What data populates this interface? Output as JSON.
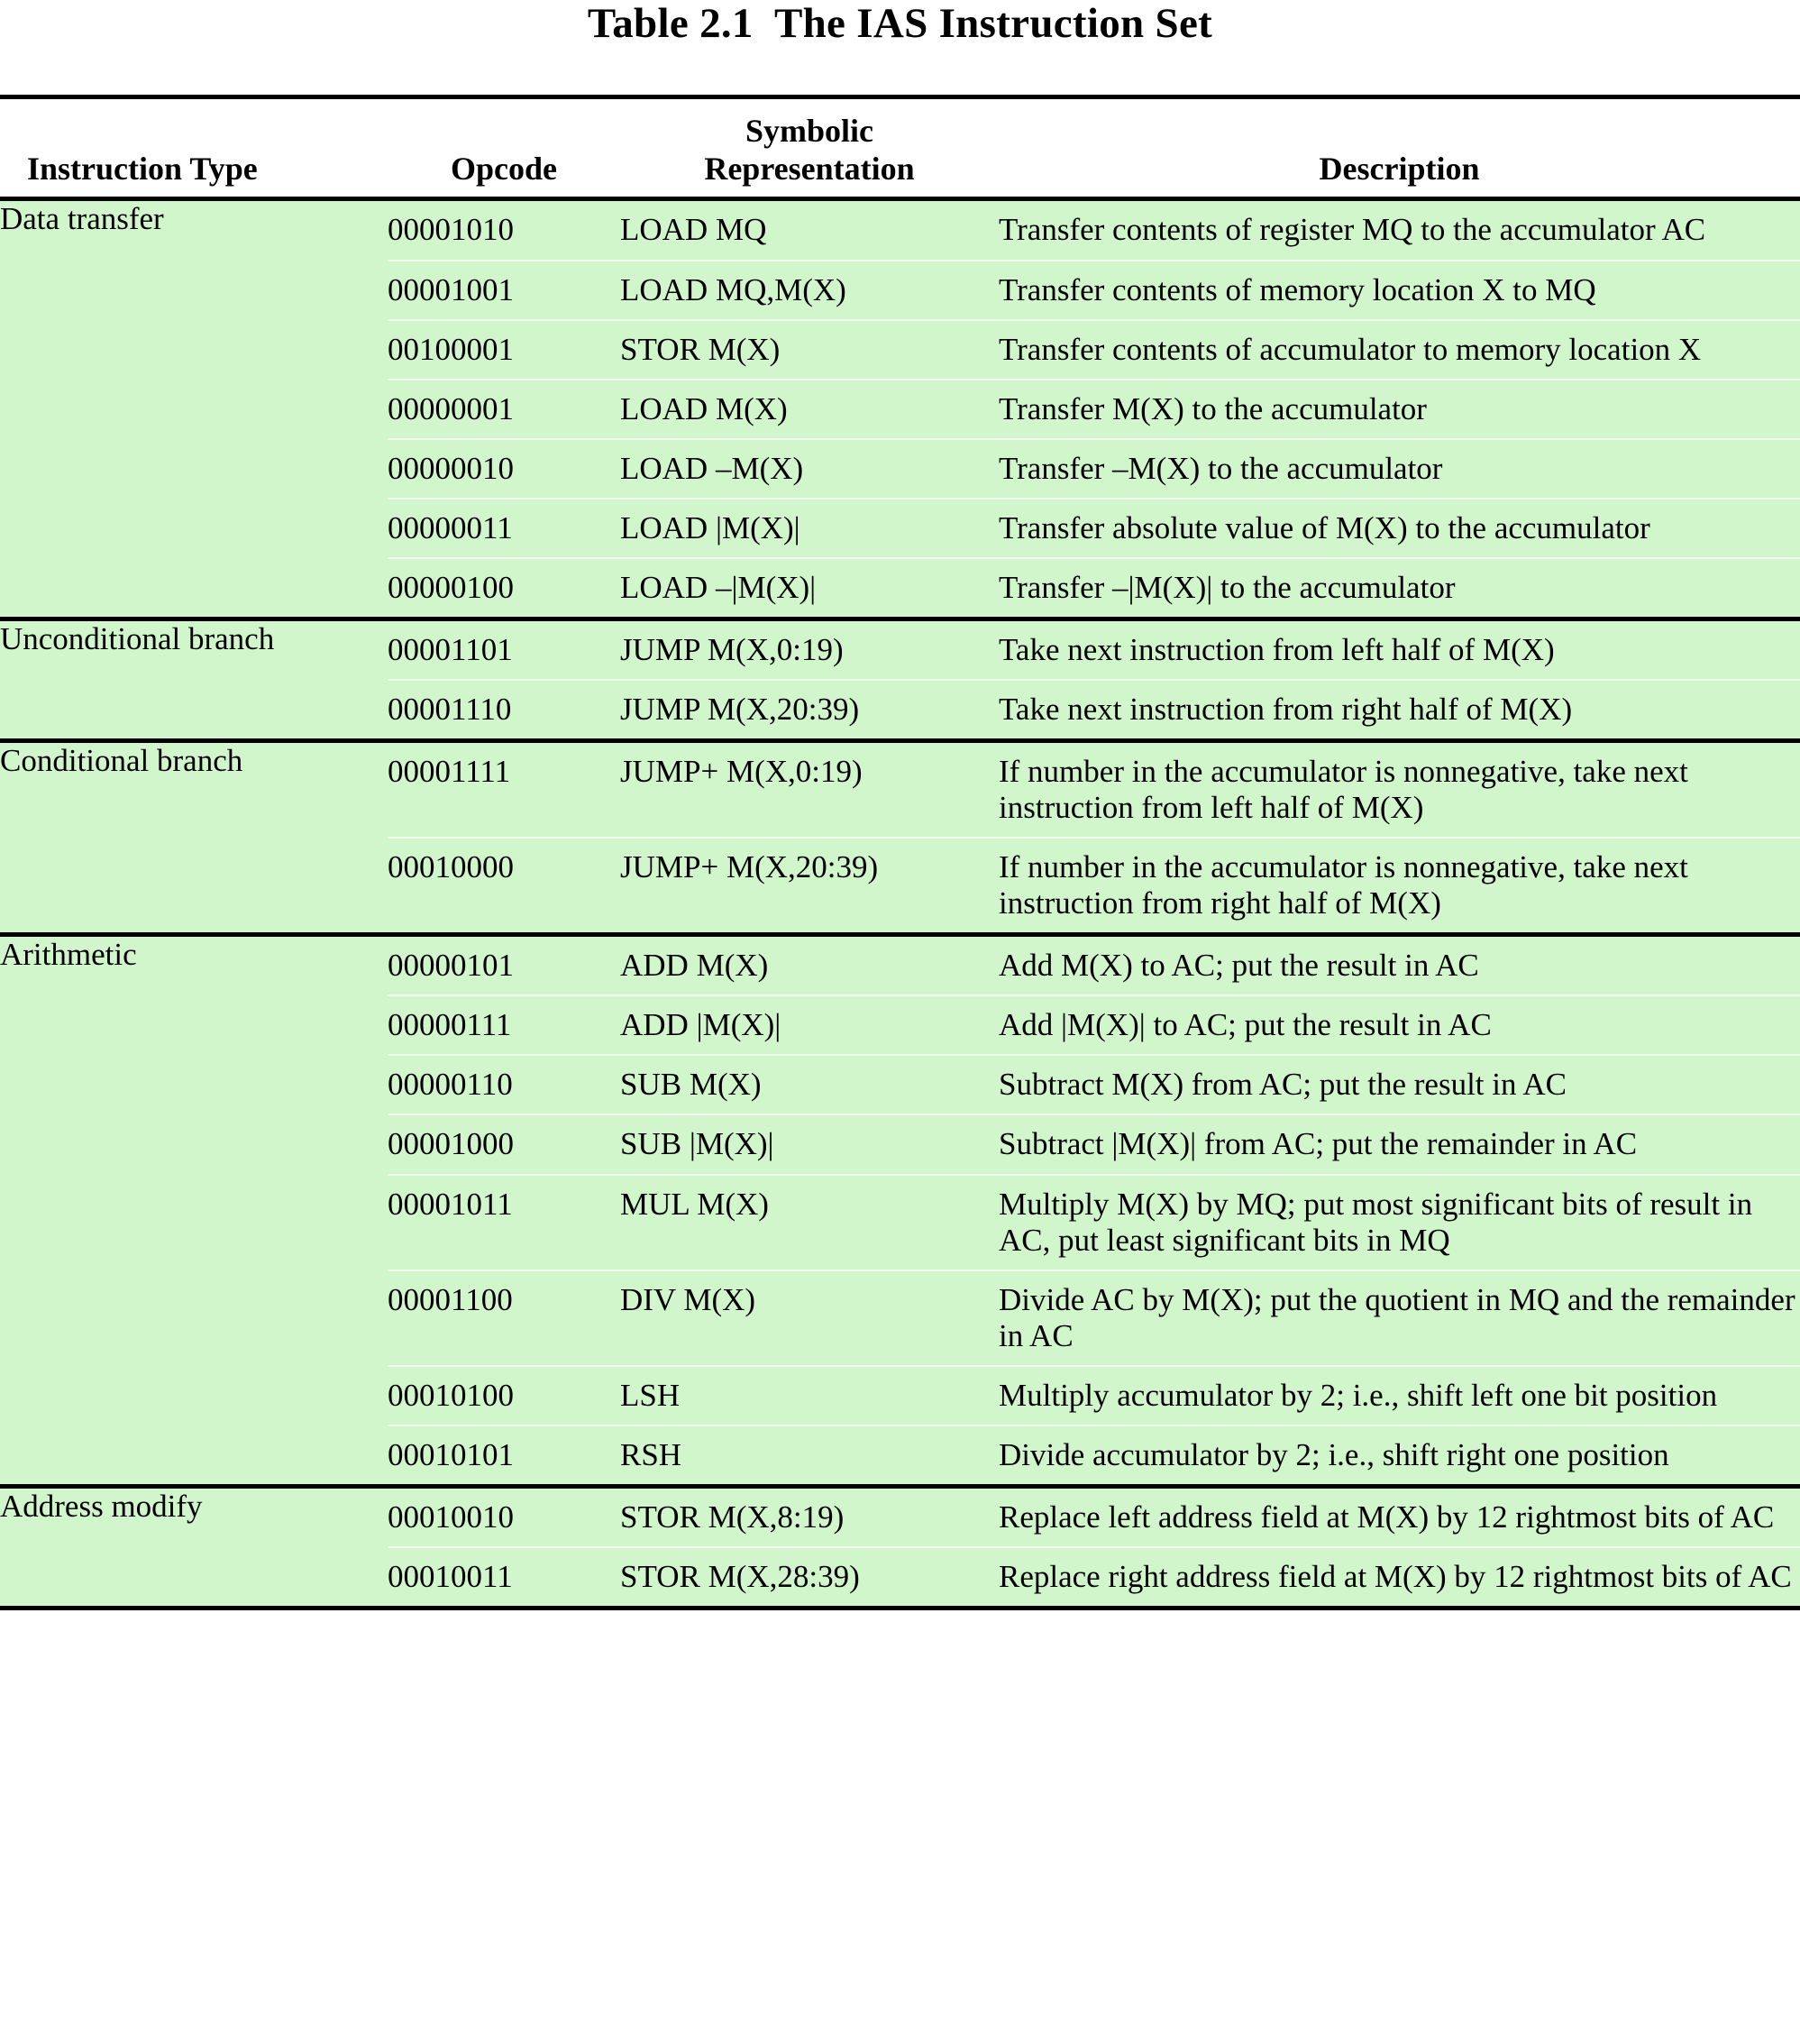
{
  "document": {
    "title": "Table 2.1  The IAS Instruction Set"
  },
  "table": {
    "columns": {
      "instruction_type": "Instruction Type",
      "opcode": "Opcode",
      "symbolic_representation_line1": "Symbolic",
      "symbolic_representation_line2": "Representation",
      "description": "Description"
    },
    "colors": {
      "row_background": "#d2f6cc",
      "page_background": "#ffffff",
      "rule": "#000000",
      "thin_separator": "#f2fdf0"
    },
    "groups": [
      {
        "type": "Data transfer",
        "rows": [
          {
            "opcode": "00001010",
            "symbolic": "LOAD MQ",
            "description": "Transfer contents of register MQ to the accumulator AC"
          },
          {
            "opcode": "00001001",
            "symbolic": "LOAD MQ,M(X)",
            "description": "Transfer contents of memory location X to MQ"
          },
          {
            "opcode": "00100001",
            "symbolic": "STOR M(X)",
            "description": "Transfer contents of accumulator to memory location X"
          },
          {
            "opcode": "00000001",
            "symbolic": "LOAD M(X)",
            "description": "Transfer M(X) to the accumulator"
          },
          {
            "opcode": "00000010",
            "symbolic": "LOAD –M(X)",
            "description": "Transfer –M(X) to the accumulator"
          },
          {
            "opcode": "00000011",
            "symbolic": "LOAD |M(X)|",
            "description": "Transfer absolute value of M(X) to the accumulator"
          },
          {
            "opcode": "00000100",
            "symbolic": "LOAD –|M(X)|",
            "description": "Transfer –|M(X)| to the accumulator"
          }
        ]
      },
      {
        "type": "Unconditional branch",
        "rows": [
          {
            "opcode": "00001101",
            "symbolic": "JUMP M(X,0:19)",
            "description": "Take next instruction from left half of M(X)"
          },
          {
            "opcode": "00001110",
            "symbolic": "JUMP M(X,20:39)",
            "description": "Take next instruction from right half of M(X)"
          }
        ]
      },
      {
        "type": "Conditional branch",
        "rows": [
          {
            "opcode": "00001111",
            "symbolic": "JUMP+ M(X,0:19)",
            "description": "If number in the accumulator is nonnegative, take next instruction from left half of M(X)"
          },
          {
            "opcode": "00010000",
            "symbolic": "JUMP+ M(X,20:39)",
            "description": "If number in the accumulator is nonnegative, take next instruction from right half of M(X)"
          }
        ]
      },
      {
        "type": "Arithmetic",
        "rows": [
          {
            "opcode": "00000101",
            "symbolic": "ADD M(X)",
            "description": "Add M(X) to AC; put the result in AC"
          },
          {
            "opcode": "00000111",
            "symbolic": "ADD |M(X)|",
            "description": "Add |M(X)| to AC; put the result in AC"
          },
          {
            "opcode": "00000110",
            "symbolic": "SUB M(X)",
            "description": "Subtract M(X) from AC; put the result in AC"
          },
          {
            "opcode": "00001000",
            "symbolic": "SUB |M(X)|",
            "description": "Subtract |M(X)| from AC; put the remainder in AC"
          },
          {
            "opcode": "00001011",
            "symbolic": "MUL M(X)",
            "description": "Multiply M(X) by MQ; put most significant bits of result in AC, put least significant bits in MQ"
          },
          {
            "opcode": "00001100",
            "symbolic": "DIV M(X)",
            "description": "Divide AC by M(X); put the quotient in MQ and the remainder in AC"
          },
          {
            "opcode": "00010100",
            "symbolic": "LSH",
            "description": "Multiply accumulator by 2; i.e., shift left one bit position"
          },
          {
            "opcode": "00010101",
            "symbolic": "RSH",
            "description": "Divide accumulator by 2; i.e., shift right one position"
          }
        ]
      },
      {
        "type": "Address modify",
        "rows": [
          {
            "opcode": "00010010",
            "symbolic": "STOR M(X,8:19)",
            "description": "Replace left address field at M(X) by 12 rightmost bits of AC"
          },
          {
            "opcode": "00010011",
            "symbolic": "STOR M(X,28:39)",
            "description": "Replace right address field at M(X) by 12 rightmost bits of AC"
          }
        ]
      }
    ]
  }
}
